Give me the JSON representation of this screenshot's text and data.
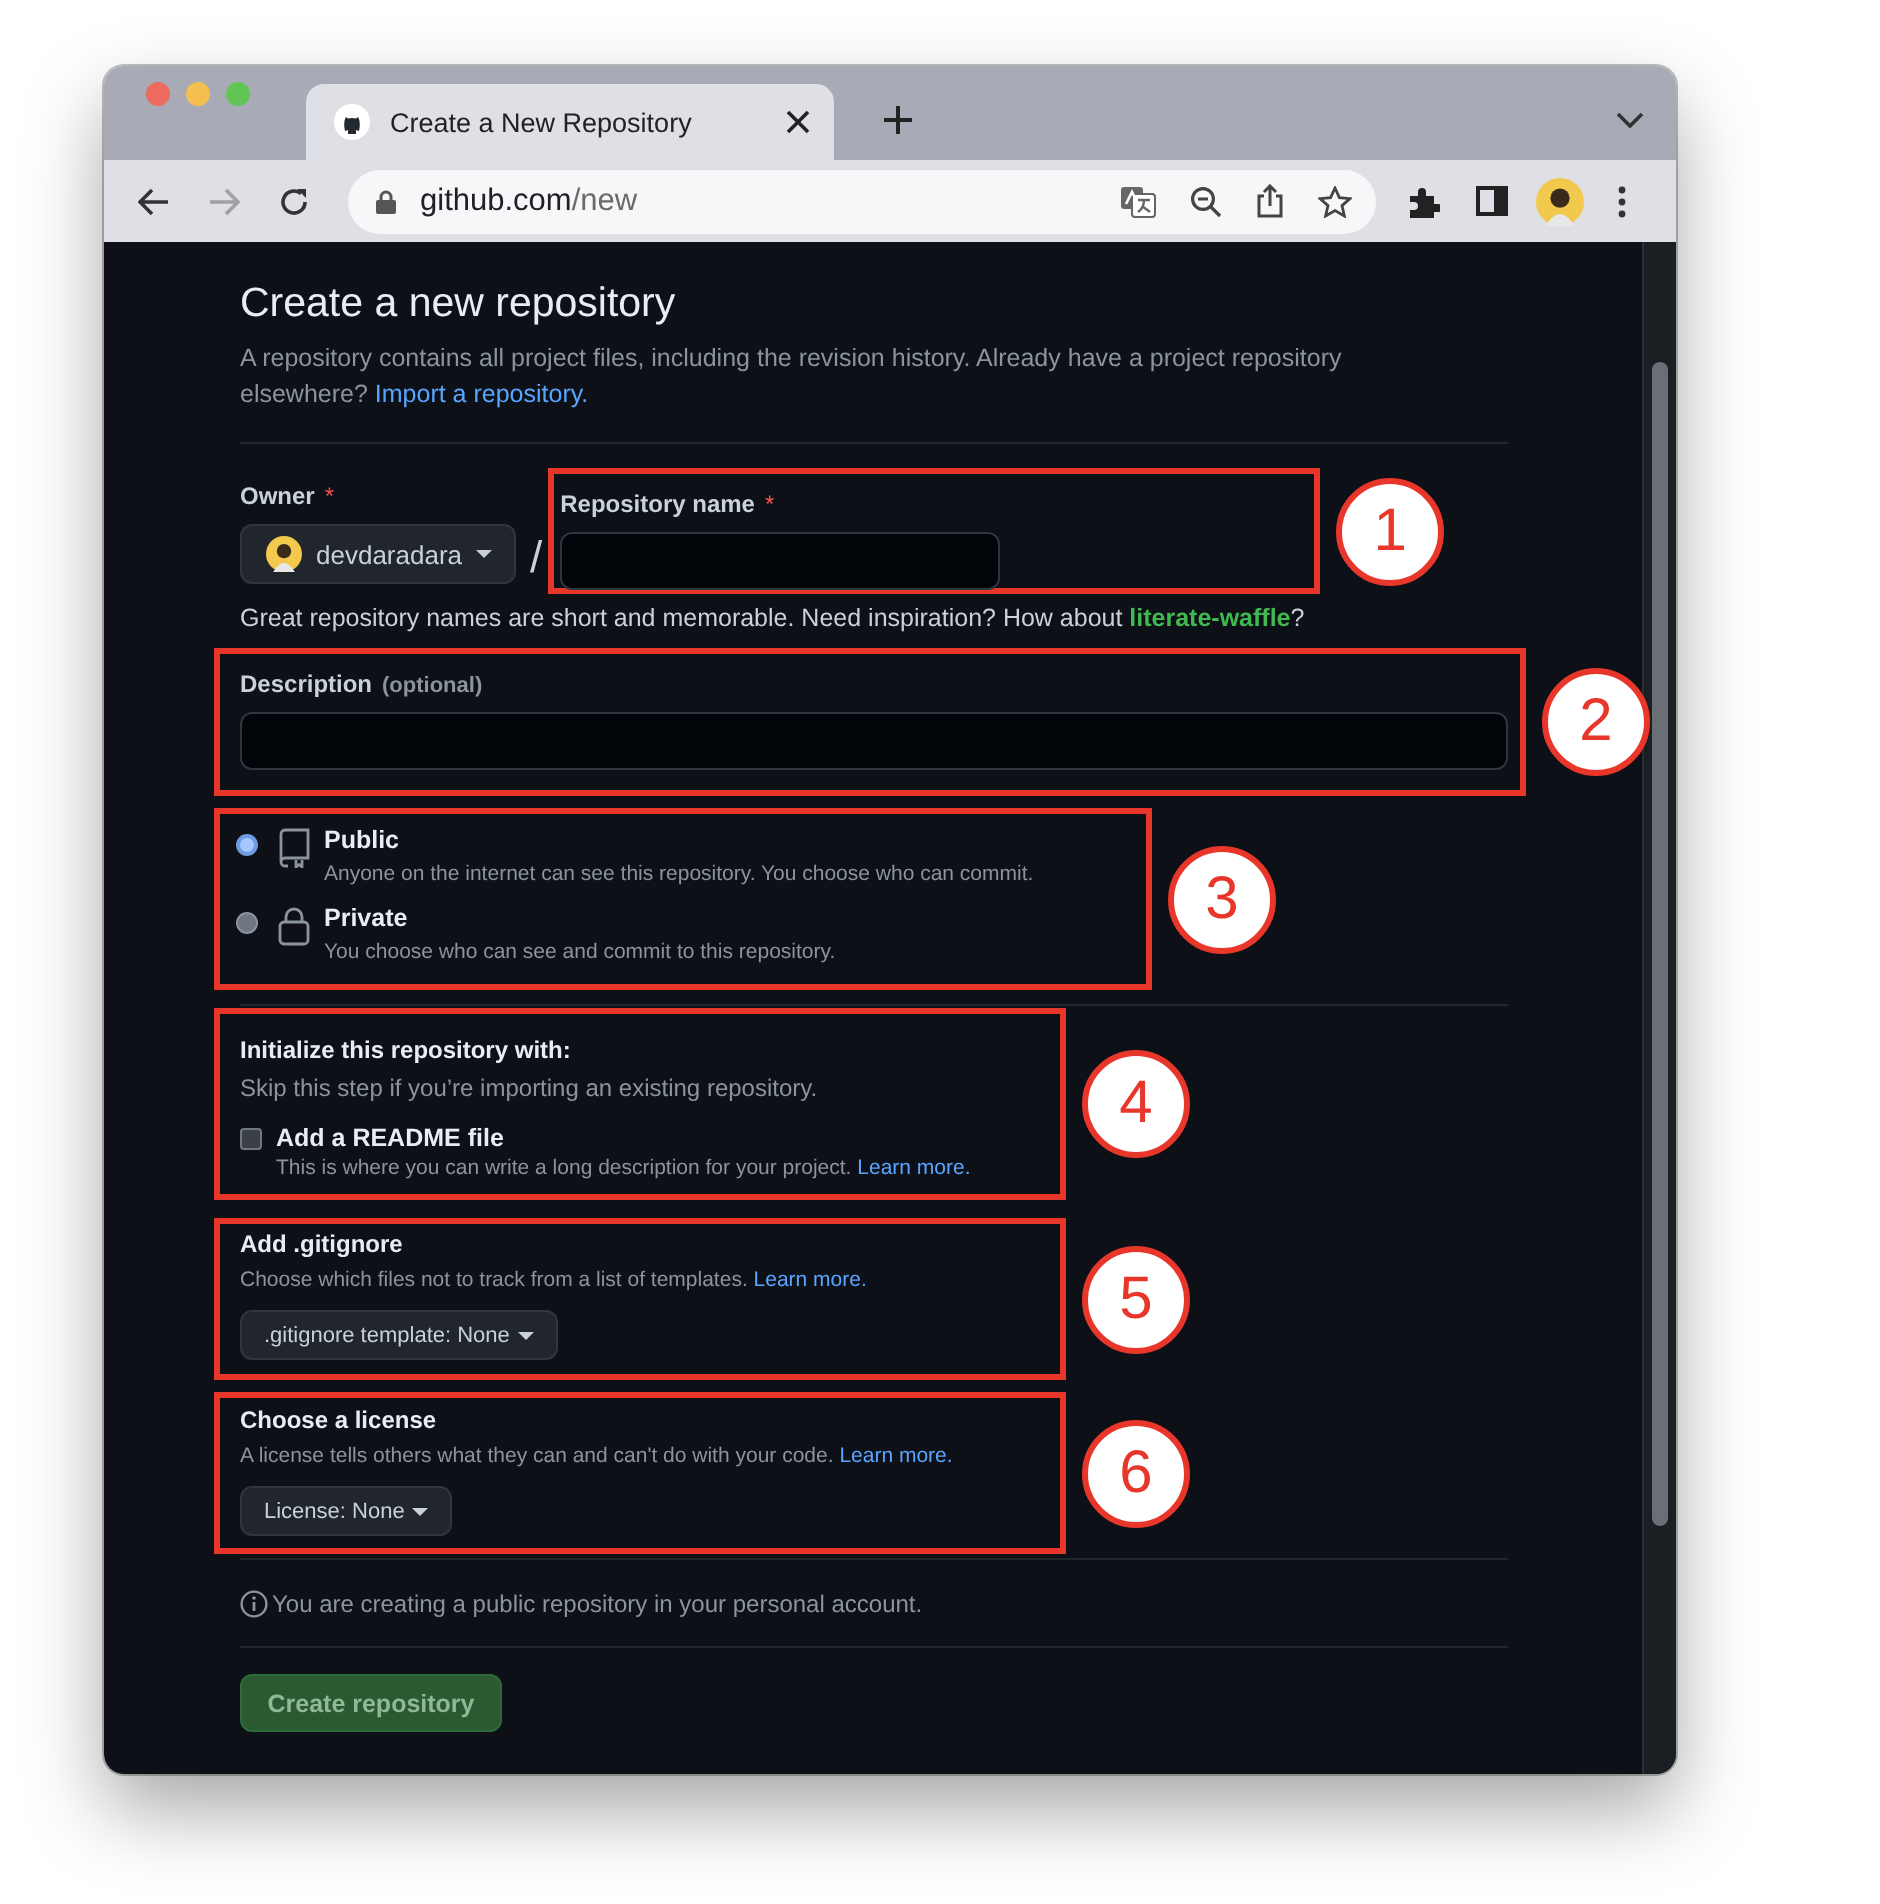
{
  "browser": {
    "tab": {
      "title": "Create a New Repository"
    },
    "url": {
      "host": "github.com",
      "path": "/new"
    },
    "forward_disabled": true
  },
  "page": {
    "title": "Create a new repository",
    "intro": "A repository contains all project files, including the revision history. Already have a project repository elsewhere?",
    "import_link": "Import a repository."
  },
  "owner": {
    "label": "Owner",
    "required_mark": "*",
    "value": "devdaradara"
  },
  "separator": "/",
  "repo_name": {
    "label": "Repository name",
    "required_mark": "*",
    "annotation": "1"
  },
  "name_hint": {
    "text": "Great repository names are short and memorable. Need inspiration? How about",
    "suggestion": "literate-waffle",
    "end": "?"
  },
  "description": {
    "label": "Description",
    "optional": "(optional)",
    "annotation": "2"
  },
  "visibility": {
    "annotation": "3",
    "options": [
      {
        "kind": "repo",
        "title": "Public",
        "text": "Anyone on the internet can see this repository. You choose who can commit.",
        "selected": true
      },
      {
        "kind": "lock",
        "title": "Private",
        "text": "You choose who can see and commit to this repository.",
        "selected": false
      }
    ]
  },
  "initialize": {
    "annotation": "4",
    "title": "Initialize this repository with:",
    "text": "Skip this step if you’re importing an existing repository.",
    "readme": {
      "label": "Add a README file",
      "text": "This is where you can write a long description for your project.",
      "link": "Learn more.",
      "checked": false
    }
  },
  "gitignore": {
    "annotation": "5",
    "title": "Add .gitignore",
    "text": "Choose which files not to track from a list of templates.",
    "link": "Learn more.",
    "button": ".gitignore template: None"
  },
  "license": {
    "annotation": "6",
    "title": "Choose a license",
    "text": "A license tells others what they can and can't do with your code.",
    "link": "Learn more.",
    "button": "License: None"
  },
  "notice": "You are creating a public repository in your personal account.",
  "submit": "Create repository"
}
